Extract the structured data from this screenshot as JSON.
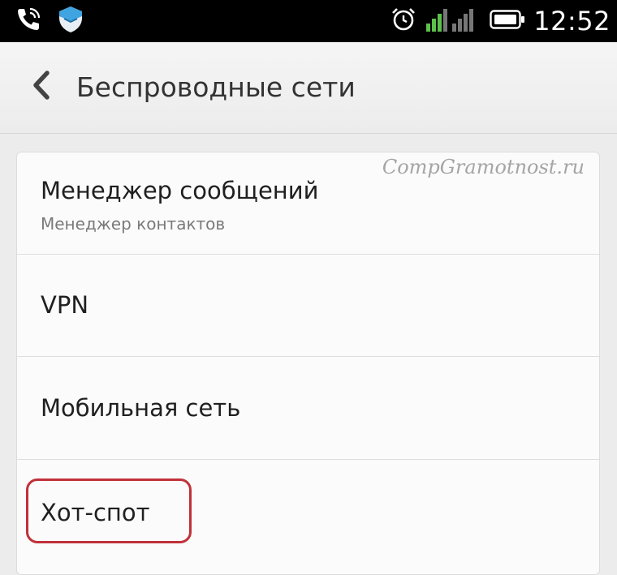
{
  "status_bar": {
    "time": "12:52",
    "icons": [
      "phone-icon",
      "shield-icon",
      "alarm-icon",
      "signal-icon",
      "battery-icon"
    ]
  },
  "header": {
    "title": "Беспроводные сети",
    "back_icon": "chevron-left-icon"
  },
  "watermark": "CompGramotnost.ru",
  "settings": {
    "items": [
      {
        "title": "Менеджер сообщений",
        "subtitle": "Менеджер контактов"
      },
      {
        "title": "VPN"
      },
      {
        "title": "Мобильная сеть"
      },
      {
        "title": "Хот-спот",
        "highlighted": true
      }
    ]
  },
  "colors": {
    "status_bar": "#000000",
    "highlight": "#c0313a",
    "background": "#ececec",
    "watermark": "#a5a5a5"
  }
}
